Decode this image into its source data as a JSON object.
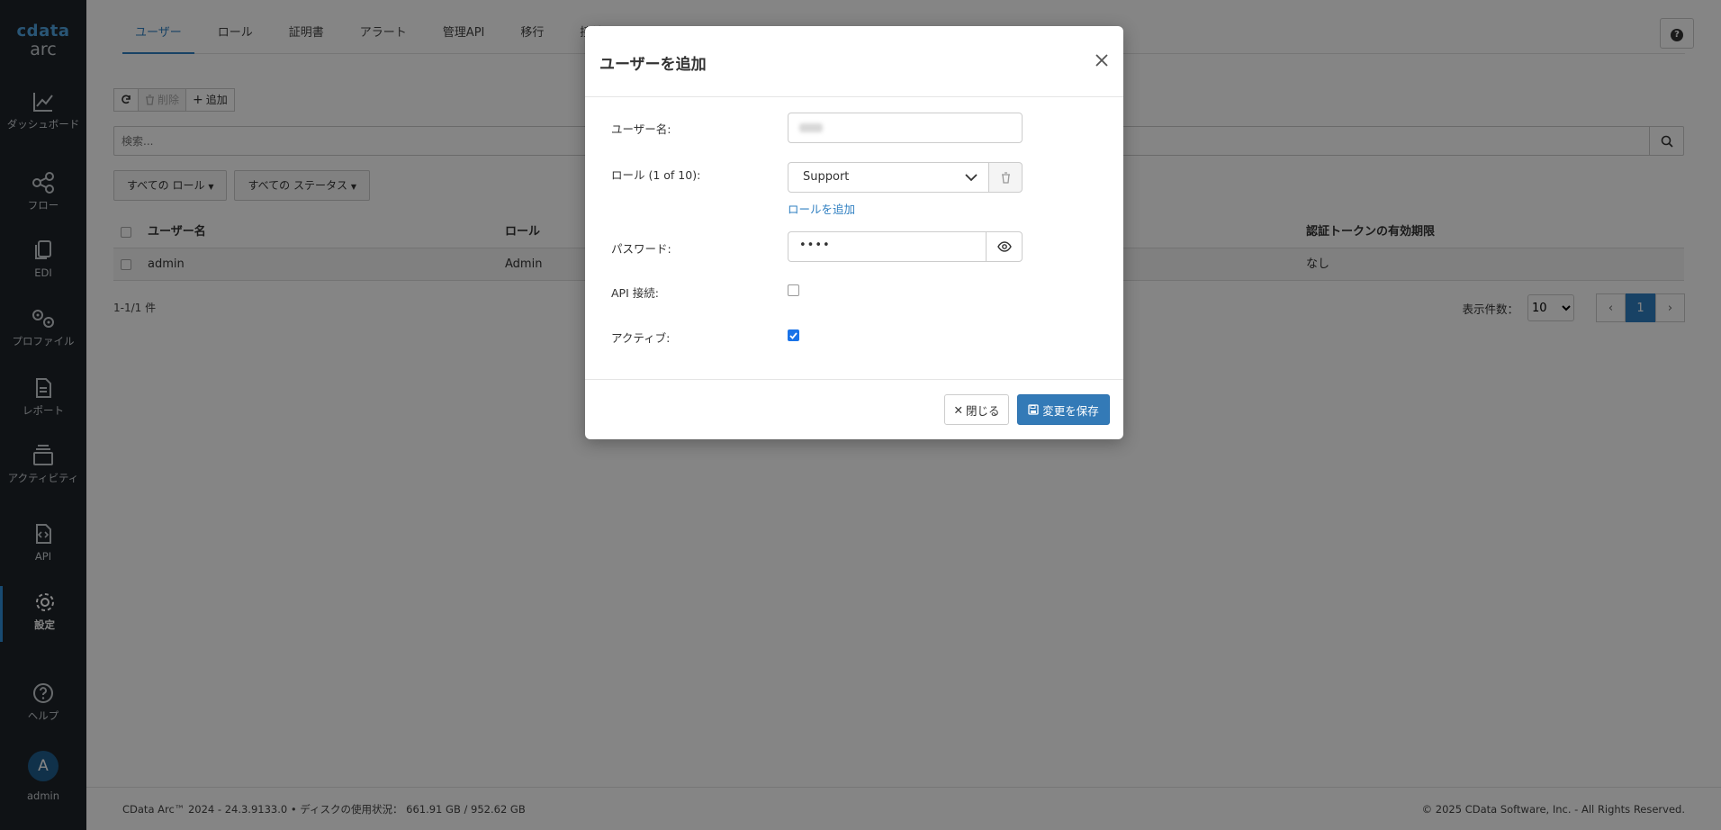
{
  "sidebar": {
    "logo_brand": "cdata",
    "logo_product": "arc",
    "items": [
      {
        "label": "ダッシュボード",
        "icon": "chart-line-icon"
      },
      {
        "label": "フロー",
        "icon": "flow-nodes-icon"
      },
      {
        "label": "EDI",
        "icon": "copy-files-icon"
      },
      {
        "label": "プロファイル",
        "icon": "gears-icon"
      },
      {
        "label": "レポート",
        "icon": "document-icon"
      },
      {
        "label": "アクティビティ",
        "icon": "layers-icon"
      },
      {
        "label": "API",
        "icon": "code-file-icon"
      },
      {
        "label": "設定",
        "icon": "gear-icon"
      },
      {
        "label": "ヘルプ",
        "icon": "question-circle-icon"
      }
    ],
    "user_initial": "A",
    "user_name": "admin"
  },
  "tabs": [
    "ユーザー",
    "ロール",
    "証明書",
    "アラート",
    "管理API",
    "移行",
    "接続"
  ],
  "active_tab": "ユーザー",
  "toolbar": {
    "delete_label": "削除",
    "add_label": "追加"
  },
  "search": {
    "placeholder": "検索..."
  },
  "filters": {
    "role": "すべての ロール",
    "status": "すべての ステータス"
  },
  "table": {
    "headers": [
      "ユーザー名",
      "ロール",
      "認証トークンの有効期限"
    ],
    "rows": [
      {
        "username": "admin",
        "role": "Admin",
        "expiry": "なし"
      }
    ]
  },
  "pagination": {
    "count_text": "1-1/1 件",
    "per_page_label": "表示件数：",
    "per_page": "10",
    "current_page": "1"
  },
  "footer": {
    "left": "CData Arc™ 2024 - 24.3.9133.0  •  ディスクの使用状況： 661.91 GB / 952.62 GB",
    "right": "© 2025 CData Software, Inc. - All Rights Reserved."
  },
  "modal": {
    "title": "ユーザーを追加",
    "username_label": "ユーザー名:",
    "role_label": "ロール (1 of 10):",
    "role_value": "Support",
    "add_role_link": "ロールを追加",
    "password_label": "パスワード:",
    "password_mask": "••••",
    "api_label": "API 接続:",
    "api_checked": false,
    "active_label": "アクティブ:",
    "active_checked": true,
    "close_button": "閉じる",
    "save_button": "変更を保存"
  },
  "colors": {
    "accent": "#2f7fc1",
    "sidebar_bg": "#1e2329",
    "save_bg": "#337ab7"
  }
}
